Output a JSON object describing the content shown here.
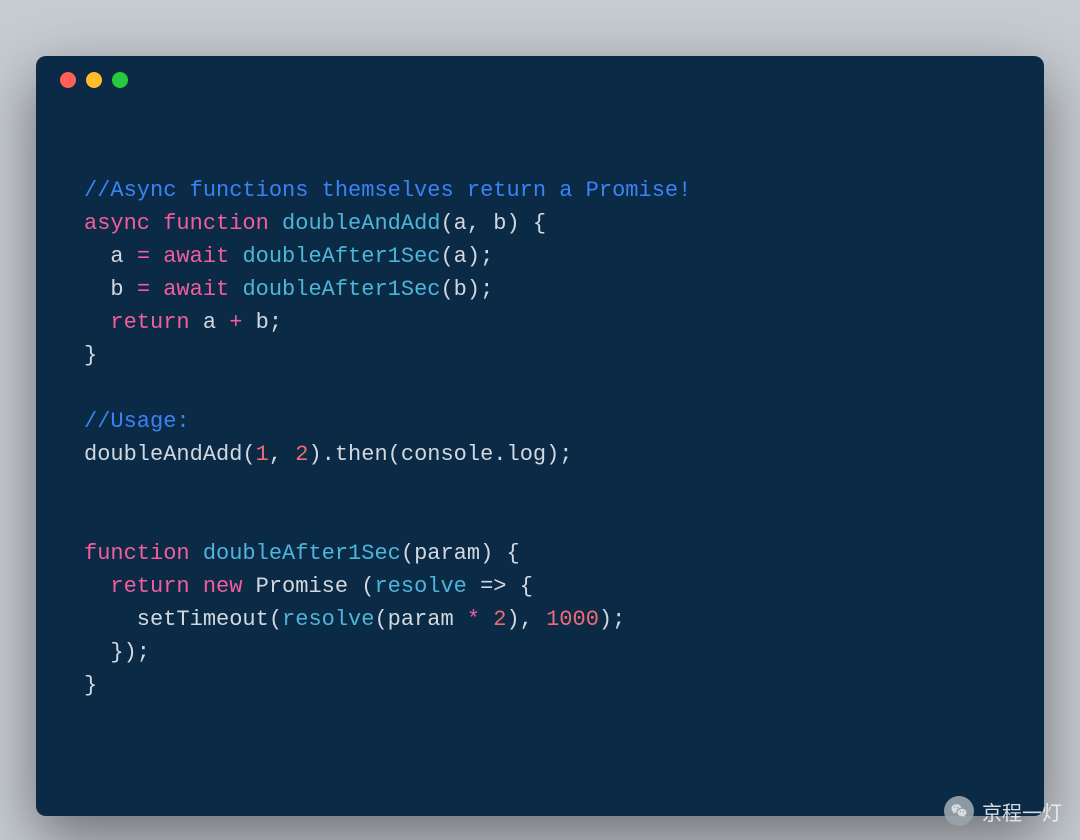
{
  "code": {
    "l1": "//Async functions themselves return a Promise!",
    "l2_async": "async",
    "l2_function": "function",
    "l2_name": "doubleAndAdd",
    "l2_params": "(a, b) {",
    "l3_a": "  a ",
    "l3_eq": "=",
    "l3_await": "await",
    "l3_call": "doubleAfter1Sec",
    "l3_arg": "(a);",
    "l4_b": "  b ",
    "l4_eq": "=",
    "l4_await": "await",
    "l4_call": "doubleAfter1Sec",
    "l4_arg": "(b);",
    "l5_return": "  return",
    "l5_expr": " a ",
    "l5_op": "+",
    "l5_expr2": " b;",
    "l6": "}",
    "l8": "//Usage:",
    "l9_call": "doubleAndAdd(",
    "l9_n1": "1",
    "l9_sep": ", ",
    "l9_n2": "2",
    "l9_rest": ").then(console.log);",
    "l12_function": "function",
    "l12_name": "doubleAfter1Sec",
    "l12_params": "(param) {",
    "l13_return": "  return",
    "l13_new": "new",
    "l13_promise": " Promise (",
    "l13_resolve": "resolve",
    "l13_arrow": " => {",
    "l14_st": "    setTimeout(",
    "l14_resolve": "resolve",
    "l14_open": "(param ",
    "l14_op": "*",
    "l14_n2": " 2",
    "l14_mid": "), ",
    "l14_ms": "1000",
    "l14_end": ");",
    "l15": "  });",
    "l16": "}"
  },
  "watermark": {
    "text": "京程一灯"
  }
}
